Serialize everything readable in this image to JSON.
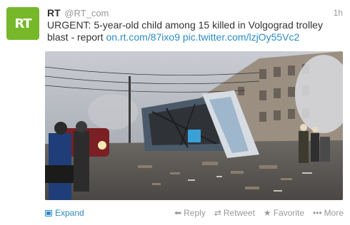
{
  "account": {
    "avatar_text": "RT",
    "name": "RT",
    "handle": "@RT_com",
    "avatar_color": "#76b82a"
  },
  "tweet": {
    "time": "1h",
    "text_prefix": "URGENT: 5-year-old child among 15 killed in Volgograd trolley blast - report ",
    "link_url": "on.rt.com/87ixo9",
    "link_pic": "pic.twitter.com/lzjOy55Vc2",
    "photo_icon": "trolley-blast-photo"
  },
  "footer": {
    "expand_label": "Expand",
    "reply_label": "Reply",
    "retweet_label": "Retweet",
    "favorite_label": "Favorite",
    "more_label": "More",
    "expand_icon": "photo-icon",
    "reply_icon": "reply-icon",
    "retweet_icon": "retweet-icon",
    "favorite_icon": "star-icon",
    "more_icon": "ellipsis-icon"
  },
  "colors": {
    "link": "#2b8bc4",
    "muted": "#999999",
    "text": "#333333"
  }
}
